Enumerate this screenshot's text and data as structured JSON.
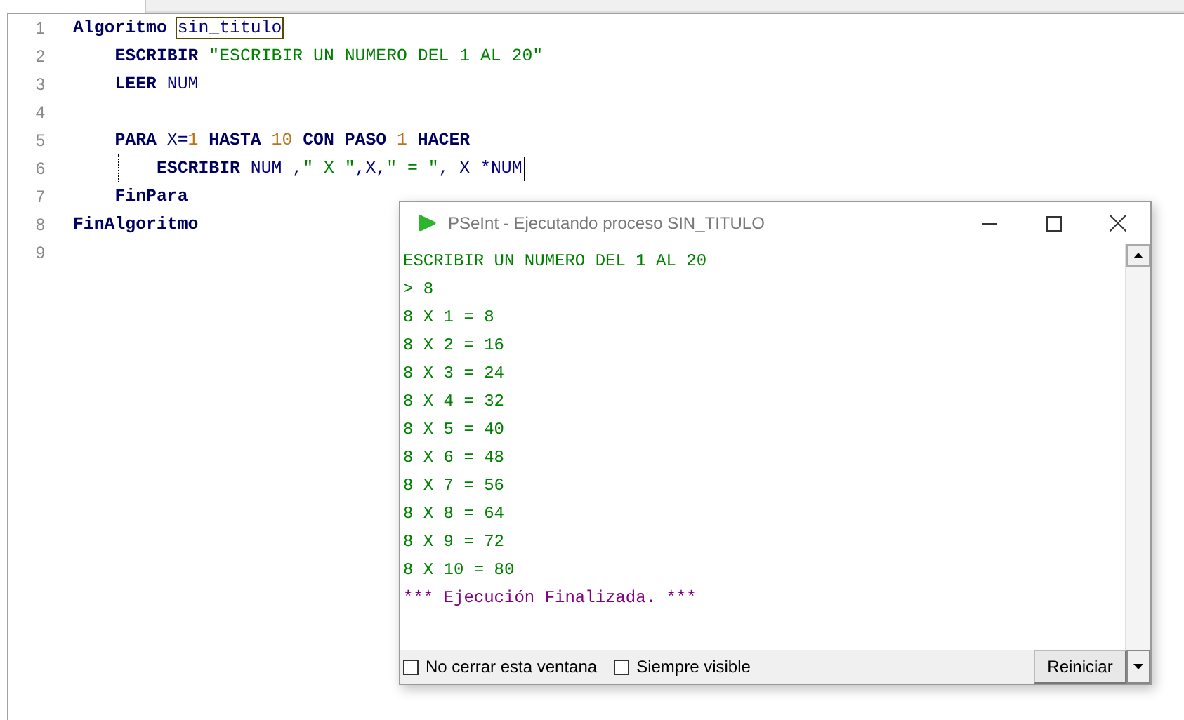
{
  "editor": {
    "lines": [
      {
        "number": "1",
        "cursor": false,
        "tokens": [
          {
            "kind": "keyword",
            "text": "Algoritmo "
          },
          {
            "kind": "highlight",
            "text": "sin_titulo"
          }
        ]
      },
      {
        "number": "2",
        "cursor": false,
        "tokens": [
          {
            "kind": "keyword",
            "text": "    ESCRIBIR "
          },
          {
            "kind": "string",
            "text": "\"ESCRIBIR UN NUMERO DEL 1 AL 20\""
          }
        ]
      },
      {
        "number": "3",
        "cursor": false,
        "tokens": [
          {
            "kind": "keyword",
            "text": "    LEER "
          },
          {
            "kind": "ident",
            "text": "NUM"
          }
        ]
      },
      {
        "number": "4",
        "cursor": false
      },
      {
        "number": "5",
        "cursor": false,
        "tokens": [
          {
            "kind": "keyword",
            "text": "    PARA "
          },
          {
            "kind": "ident",
            "text": "X="
          },
          {
            "kind": "number",
            "text": "1"
          },
          {
            "kind": "keyword",
            "text": " HASTA "
          },
          {
            "kind": "number",
            "text": "10"
          },
          {
            "kind": "keyword",
            "text": " CON PASO "
          },
          {
            "kind": "number",
            "text": "1"
          },
          {
            "kind": "keyword",
            "text": " HACER"
          }
        ]
      },
      {
        "number": "6",
        "cursor": true,
        "tokens": [
          {
            "kind": "keyword",
            "text": "        ESCRIBIR "
          },
          {
            "kind": "ident",
            "text": "NUM ,"
          },
          {
            "kind": "string",
            "text": "\" X \""
          },
          {
            "kind": "ident",
            "text": ",X,"
          },
          {
            "kind": "string",
            "text": "\" = \""
          },
          {
            "kind": "ident",
            "text": ", X *NUM"
          }
        ]
      },
      {
        "number": "7",
        "cursor": false,
        "tokens": [
          {
            "kind": "keyword",
            "text": "    FinPara"
          }
        ]
      },
      {
        "number": "8",
        "cursor": false,
        "tokens": [
          {
            "kind": "keyword",
            "text": "FinAlgoritmo"
          }
        ]
      },
      {
        "number": "9",
        "cursor": false
      }
    ]
  },
  "console": {
    "title": "PSeInt - Ejecutando proceso SIN_TITULO",
    "output": [
      {
        "kind": "output",
        "text": "ESCRIBIR UN NUMERO DEL 1 AL 20"
      },
      {
        "kind": "input",
        "text": "> 8"
      },
      {
        "kind": "output",
        "text": "8 X 1 = 8"
      },
      {
        "kind": "output",
        "text": "8 X 2 = 16"
      },
      {
        "kind": "output",
        "text": "8 X 3 = 24"
      },
      {
        "kind": "output",
        "text": "8 X 4 = 32"
      },
      {
        "kind": "output",
        "text": "8 X 5 = 40"
      },
      {
        "kind": "output",
        "text": "8 X 6 = 48"
      },
      {
        "kind": "output",
        "text": "8 X 7 = 56"
      },
      {
        "kind": "output",
        "text": "8 X 8 = 64"
      },
      {
        "kind": "output",
        "text": "8 X 9 = 72"
      },
      {
        "kind": "output",
        "text": "8 X 10 = 80"
      },
      {
        "kind": "status",
        "text": "*** Ejecución Finalizada. ***"
      }
    ],
    "options": [
      {
        "label": "No cerrar esta ventana",
        "checked": false
      },
      {
        "label": "Siempre visible",
        "checked": false
      }
    ],
    "button": "Reiniciar"
  }
}
